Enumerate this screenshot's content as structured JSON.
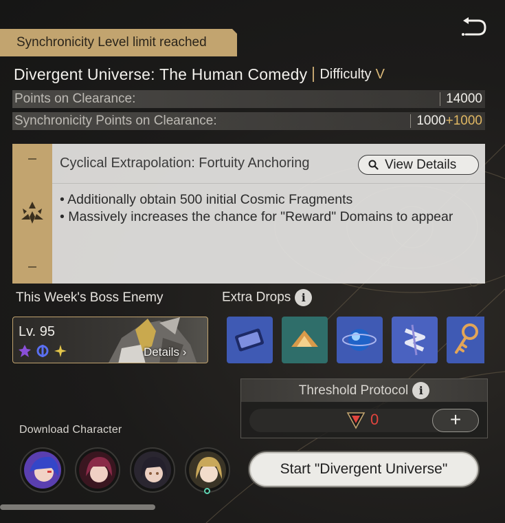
{
  "banner": {
    "sync_limit": "Synchronicity Level limit reached"
  },
  "header": {
    "title": "Divergent Universe: The Human Comedy",
    "difficulty_label": "Difficulty",
    "difficulty_value": "V"
  },
  "stats": {
    "points_label": "Points on Clearance:",
    "points_value": "14000",
    "sync_label": "Synchronicity Points on Clearance:",
    "sync_base": "1000",
    "sync_bonus": "+1000"
  },
  "blessing": {
    "title": "Cyclical Extrapolation: Fortuity Anchoring",
    "view_details": "View Details",
    "line1": "• Additionally obtain 500 initial Cosmic Fragments",
    "line2": "• Massively increases the chance for \"Reward\" Domains to appear"
  },
  "boss": {
    "section_label": "This Week's Boss Enemy",
    "level": "Lv. 95",
    "details": "Details",
    "weakness_icons": [
      "quantum-icon",
      "imaginary-icon",
      "imaginary-star-icon"
    ]
  },
  "drops": {
    "section_label": "Extra Drops",
    "items": [
      "ticket-icon",
      "fuel-icon",
      "orb-icon",
      "spiral-icon",
      "key-icon"
    ]
  },
  "threshold": {
    "label": "Threshold Protocol",
    "value": "0",
    "plus": "+"
  },
  "download": {
    "label": "Download Character"
  },
  "start_button": "Start \"Divergent Universe\"",
  "colors": {
    "accent": "#c2a46f",
    "gold_text": "#e0b763",
    "threshold_red": "#e2453e"
  }
}
